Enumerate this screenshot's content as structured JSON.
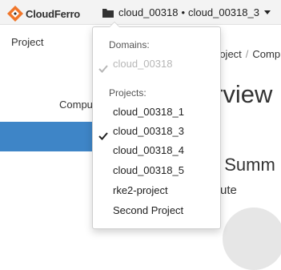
{
  "brand": {
    "name": "CloudFerro",
    "accent_color": "#f0762a"
  },
  "context": {
    "domain": "cloud_00318",
    "project": "cloud_00318_3",
    "separator": "•"
  },
  "nav": {
    "project_label": "Project",
    "compute_label": "Compu"
  },
  "breadcrumb": {
    "item1": "roject",
    "sep": "/",
    "item2": "Comput"
  },
  "page": {
    "title": "rview",
    "summary_title": "t Summ",
    "summary_sub": "ute",
    "fragment": "y"
  },
  "dropdown": {
    "domains_header": "Domains:",
    "domains": [
      {
        "label": "cloud_00318",
        "checked": true,
        "disabled": true
      }
    ],
    "projects_header": "Projects:",
    "projects": [
      {
        "label": "cloud_00318_1",
        "checked": false
      },
      {
        "label": "cloud_00318_3",
        "checked": true
      },
      {
        "label": "cloud_00318_4",
        "checked": false
      },
      {
        "label": "cloud_00318_5",
        "checked": false
      },
      {
        "label": "rke2-project",
        "checked": false
      },
      {
        "label": "Second Project",
        "checked": false
      }
    ]
  },
  "icons": {
    "logo": "cloudferro-logo-icon",
    "context": "folder-icon",
    "check": "checkmark-icon"
  },
  "colors": {
    "active_nav": "#3e85c7",
    "check_disabled": "#b7b7b7"
  }
}
